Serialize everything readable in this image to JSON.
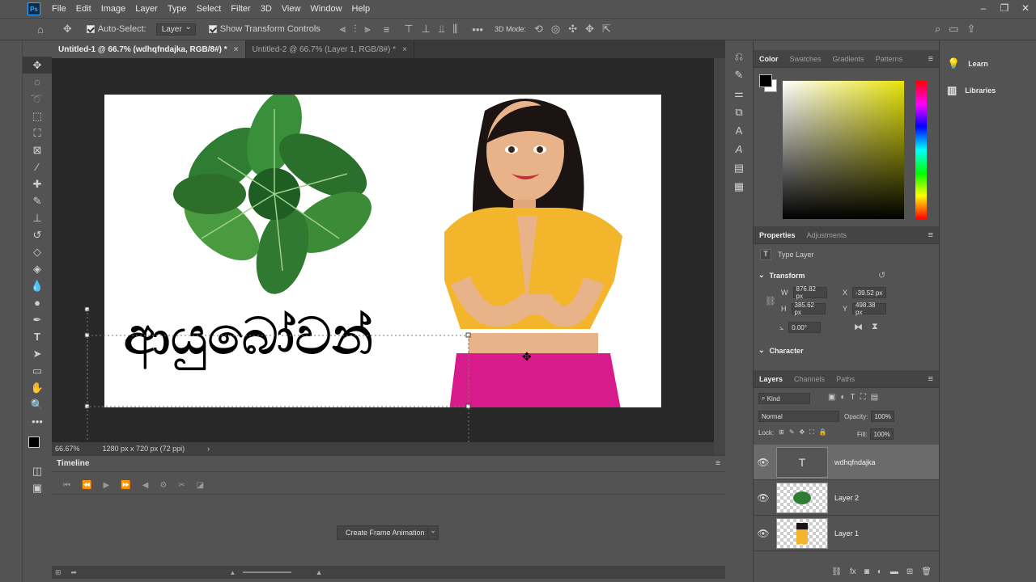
{
  "app": {
    "logo": "Ps"
  },
  "menu": [
    "File",
    "Edit",
    "Image",
    "Layer",
    "Type",
    "Select",
    "Filter",
    "3D",
    "View",
    "Window",
    "Help"
  ],
  "window_controls": [
    "–",
    "❐",
    "✕"
  ],
  "options": {
    "auto_select_label": "Auto-Select:",
    "auto_select_value": "Layer",
    "show_transform_label": "Show Transform Controls",
    "mode_3d_label": "3D Mode:",
    "more": "•••"
  },
  "tabs": [
    {
      "label": "Untitled-1 @ 66.7% (wdhqfndajka, RGB/8#) *",
      "active": true
    },
    {
      "label": "Untitled-2 @ 66.7% (Layer 1, RGB/8#) *",
      "active": false
    }
  ],
  "canvas": {
    "text": "ආයුබෝවන්"
  },
  "status": {
    "zoom": "66.67%",
    "doc_size": "1280 px x 720 px (72 ppi)",
    "arrow": "›"
  },
  "timeline": {
    "title": "Timeline",
    "create_button": "Create Frame Animation"
  },
  "color_panel": {
    "tabs": [
      "Color",
      "Swatches",
      "Gradients",
      "Patterns"
    ],
    "fg_color": "#000000",
    "bg_color": "#ffffff"
  },
  "properties": {
    "tabs": [
      "Properties",
      "Adjustments"
    ],
    "kind": "Type Layer",
    "transform_title": "Transform",
    "w_label": "W",
    "w_value": "876.82 px",
    "h_label": "H",
    "h_value": "385.62 px",
    "x_label": "X",
    "x_value": "-39.52 px",
    "y_label": "Y",
    "y_value": "498.38 px",
    "angle_value": "0.00°",
    "character_title": "Character"
  },
  "layers_panel": {
    "tabs": [
      "Layers",
      "Channels",
      "Paths"
    ],
    "filter_label": "Kind",
    "blend_mode": "Normal",
    "opacity_label": "Opacity:",
    "opacity_value": "100%",
    "lock_label": "Lock:",
    "fill_label": "Fill:",
    "fill_value": "100%",
    "layers": [
      {
        "name": "wdhqfndajka",
        "type": "text",
        "selected": true
      },
      {
        "name": "Layer 2",
        "type": "leaves",
        "selected": false
      },
      {
        "name": "Layer 1",
        "type": "woman",
        "selected": false
      }
    ]
  },
  "side_panels": [
    {
      "label": "Learn",
      "icon": "lightbulb-icon"
    },
    {
      "label": "Libraries",
      "icon": "libraries-icon"
    }
  ]
}
